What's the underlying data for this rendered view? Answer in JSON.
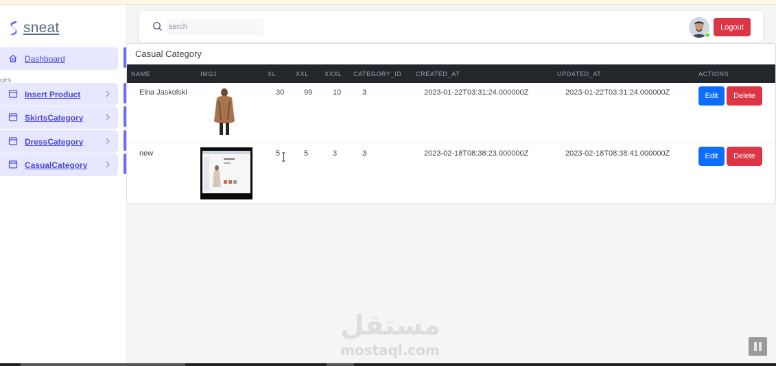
{
  "app": {
    "brand": "sneat"
  },
  "sidebar": {
    "pages_label": "ges",
    "items": [
      {
        "label": "Dashboard",
        "icon": "home-icon"
      },
      {
        "label": "Insert Product",
        "icon": "window-icon"
      },
      {
        "label": "SkirtsCategory",
        "icon": "window-icon"
      },
      {
        "label": "DressCategory",
        "icon": "window-icon"
      },
      {
        "label": "CasualCategory",
        "icon": "window-icon"
      }
    ]
  },
  "navbar": {
    "search_placeholder": "serch",
    "logout_label": "Logout"
  },
  "card": {
    "title": "Casual Category",
    "columns": [
      "NAME",
      "IMG1",
      "XL",
      "XXL",
      "XXXL",
      "CATEGORY_ID",
      "CREATED_AT",
      "UPDATED_AT",
      "ACTIONS"
    ],
    "rows": [
      {
        "name": "Elna Jaskolski",
        "xl": "30",
        "xxl": "99",
        "xxxl": "10",
        "category_id": "3",
        "created_at": "2023-01-22T03:31:24.000000Z",
        "updated_at": "2023-01-22T03:31:24.000000Z",
        "edit_label": "Edit",
        "delete_label": "Delete"
      },
      {
        "name": "new",
        "xl": "5",
        "xxl": "5",
        "xxxl": "3",
        "category_id": "3",
        "created_at": "2023-02-18T08:38:23.000000Z",
        "updated_at": "2023-02-18T08:38:41.000000Z",
        "edit_label": "Edit",
        "delete_label": "Delete"
      }
    ]
  },
  "watermark": {
    "arabic": "مستقل",
    "latin": "mostaql.com"
  },
  "colors": {
    "accent": "#696cff",
    "edit": "#0d6efd",
    "danger": "#dc3545",
    "table_header": "#23272b"
  }
}
